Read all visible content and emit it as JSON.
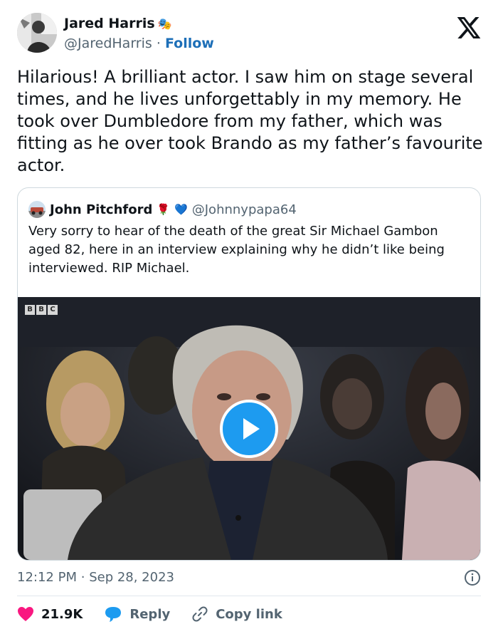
{
  "author": {
    "display_name": "Jared Harris",
    "badge_emoji": "🎭",
    "handle": "@JaredHarris",
    "separator": "·",
    "follow_label": "Follow"
  },
  "tweet": {
    "text": "Hilarious! A brilliant actor. I saw him on stage several times, and he lives unforgettably in my memory. He took over Dumbledore from my father, which was fitting as he over took Brando as my father’s favourite actor."
  },
  "quoted": {
    "display_name": "John Pitchford",
    "rose_emoji": "🌹",
    "heart_emoji": "💙",
    "handle": "@Johnnypapa64",
    "text": "Very sorry to hear of the death of the great Sir Michael Gambon aged 82, here in an interview explaining why he didn’t like being interviewed. RIP Michael.",
    "video": {
      "channel_logo": [
        "B",
        "B",
        "C"
      ]
    }
  },
  "footer": {
    "time": "12:12 PM",
    "separator": "·",
    "date": "Sep 28, 2023"
  },
  "actions": {
    "likes": "21.9K",
    "reply": "Reply",
    "copy_link": "Copy link"
  },
  "colors": {
    "accent": "#1d9bf0",
    "follow": "#1d6fb8",
    "heart": "#f91880",
    "secondary_text": "#536471"
  },
  "icons": [
    "x-logo-icon",
    "play-icon",
    "info-icon",
    "heart-icon",
    "reply-icon",
    "link-icon"
  ]
}
